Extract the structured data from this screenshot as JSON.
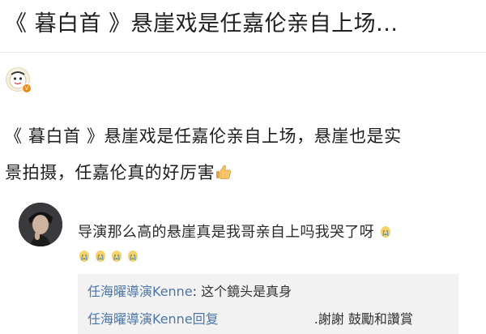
{
  "post": {
    "title": "《 暮白首 》悬崖戏是任嘉伦亲自上场...",
    "body_line1": "《 暮白首 》悬崖戏是任嘉伦亲自上场，悬崖也是实",
    "body_line2": "景拍摄，任嘉伦真的好厉害"
  },
  "comment": {
    "text": "导演那么高的悬崖真是我哥亲自上吗我哭了呀",
    "emoji_icon": "crying-face-icon"
  },
  "replies": [
    {
      "author": "任海曜導演Kenne",
      "separator": ": ",
      "text": "这个鏡头是真身"
    },
    {
      "author": "任海曜導演Kenne",
      "separator": "回复",
      "text": ".謝謝 鼓勵和讚賞"
    }
  ],
  "colors": {
    "author_link": "#4a76a8",
    "reply_bg": "#f2f2f2"
  }
}
